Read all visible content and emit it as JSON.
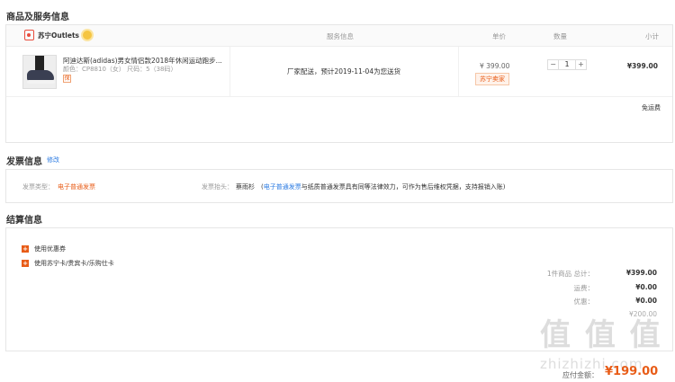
{
  "goods": {
    "section_title": "商品及服务信息",
    "store_name": "苏宁Outlets",
    "columns": {
      "service": "服务信息",
      "price": "单价",
      "quantity": "数量",
      "subtotal": "小计"
    },
    "item": {
      "name": "阿迪达斯(adidas)男女情侣款2018年休闲运动跑步...",
      "spec": "颜色：CP8810（女）  尺码：5（38码）",
      "guarantee_icon": "保",
      "delivery": "厂家配送，预计2019-11-04为您送货",
      "price": "¥ 399.00",
      "tag": "苏宁卖家",
      "qty_minus": "−",
      "qty": "1",
      "qty_plus": "+",
      "subtotal": "¥399.00"
    },
    "shipping": "免运费"
  },
  "invoice": {
    "section_title": "发票信息",
    "edit": "修改",
    "type_label": "发票类型：",
    "type_value": "电子普通发票",
    "header_label": "发票抬头：",
    "header_value": "蔡雨杉",
    "note_prefix": "(",
    "note_link": "电子普通发票",
    "note_text": "与纸质普通发票具有同等法律效力，可作为售后维权凭据，支持报销入账)"
  },
  "settlement": {
    "section_title": "结算信息",
    "options": [
      "使用优惠券",
      "使用苏宁卡/贵宾卡/乐购仕卡"
    ],
    "rows": [
      {
        "label": "1件商品 总计：",
        "value": "¥399.00"
      },
      {
        "label": "运费：",
        "value": "¥0.00"
      },
      {
        "label": "优惠：",
        "value": "¥0.00"
      },
      {
        "label": "",
        "value": "¥200.00"
      }
    ],
    "pay_label": "应付金额：",
    "pay_amount": "¥199.00",
    "watermark": "值 值 值",
    "watermark_url": "zhizhizhi.com"
  },
  "colors": {
    "accent": "#e85c17",
    "link": "#2a7ae2"
  }
}
